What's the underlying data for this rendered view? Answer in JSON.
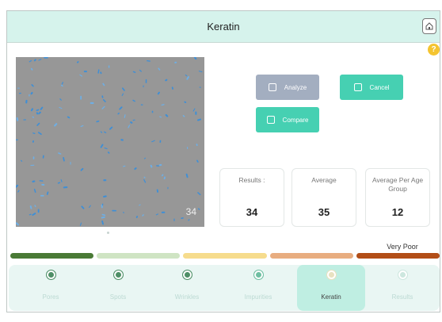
{
  "header": {
    "title": "Keratin",
    "home_icon": "home-icon"
  },
  "help": {
    "label": "?"
  },
  "sample": {
    "count": "34"
  },
  "actions": {
    "analyze": "Analyze",
    "cancel": "Cancel",
    "compare": "Compare"
  },
  "stats": [
    {
      "label": "Results :",
      "value": "34"
    },
    {
      "label": "Average",
      "value": "35"
    },
    {
      "label": "Average Per Age Group",
      "value": "12"
    }
  ],
  "verdict": "Very Poor",
  "scale_colors": [
    "#4a7a36",
    "#cfe4c3",
    "#f6dc8d",
    "#e8ad80",
    "#b24e17"
  ],
  "tabs": [
    {
      "label": "Pores",
      "icon": "pores-icon",
      "color": "#4e8f66"
    },
    {
      "label": "Spots",
      "icon": "spots-icon",
      "color": "#4e8f66"
    },
    {
      "label": "Wrinkles",
      "icon": "wrinkles-icon",
      "color": "#4e8f66"
    },
    {
      "label": "Impurities",
      "icon": "impurities-icon",
      "color": "#6fbfa2"
    },
    {
      "label": "Keratin",
      "icon": "keratin-icon",
      "color": "#e8e1c0"
    },
    {
      "label": "Results",
      "icon": "results-icon",
      "color": "#cde7df"
    }
  ]
}
